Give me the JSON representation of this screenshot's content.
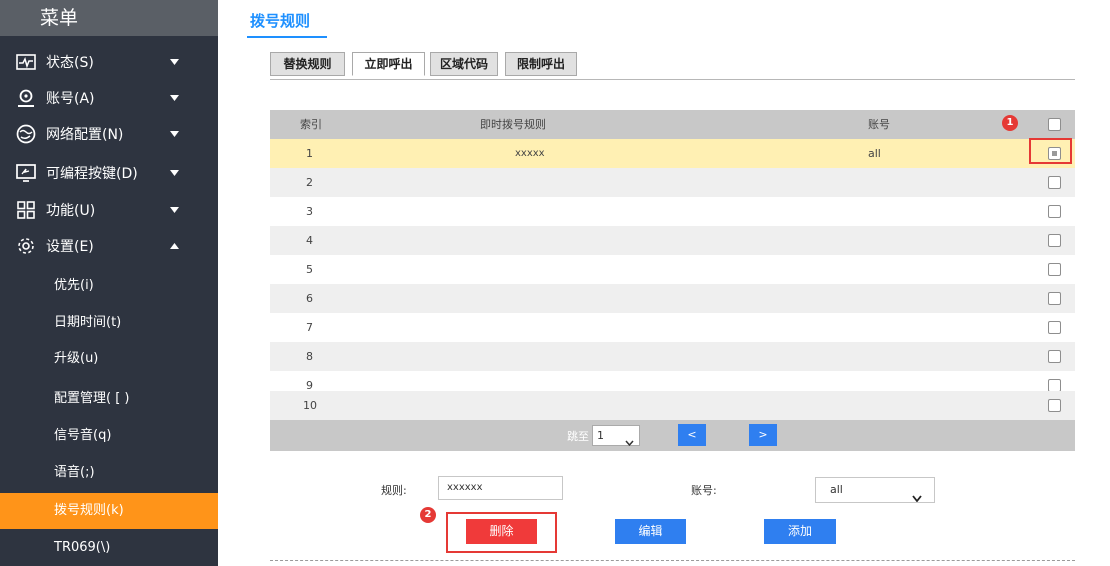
{
  "sidebar": {
    "title": "菜单",
    "items": [
      {
        "label": "状态(S)",
        "icon": "status-icon",
        "expanded": false
      },
      {
        "label": "账号(A)",
        "icon": "account-icon",
        "expanded": false
      },
      {
        "label": "网络配置(N)",
        "icon": "network-icon",
        "expanded": false
      },
      {
        "label": "可编程按键(D)",
        "icon": "programmable-key-icon",
        "expanded": false
      },
      {
        "label": "功能(U)",
        "icon": "features-icon",
        "expanded": false
      },
      {
        "label": "设置(E)",
        "icon": "settings-icon",
        "expanded": true
      }
    ],
    "sub_items": [
      {
        "label": "优先(i)"
      },
      {
        "label": "日期时间(t)"
      },
      {
        "label": "升级(u)"
      },
      {
        "label": "配置管理( [ )"
      },
      {
        "label": "信号音(q)"
      },
      {
        "label": "语音(;)"
      },
      {
        "label": "拨号规则(k)",
        "active": true
      },
      {
        "label": "TR069(\\)"
      }
    ]
  },
  "main": {
    "title": "拨号规则",
    "tabs": [
      {
        "label": "替换规则",
        "active": false
      },
      {
        "label": "立即呼出",
        "active": true
      },
      {
        "label": "区域代码",
        "active": false
      },
      {
        "label": "限制呼出",
        "active": false
      }
    ],
    "table": {
      "headers": {
        "index": "索引",
        "rule": "即时拨号规则",
        "account": "账号"
      },
      "rows": [
        {
          "index": "1",
          "rule": "xxxxx",
          "account": "all",
          "selected": true
        },
        {
          "index": "2",
          "rule": "",
          "account": ""
        },
        {
          "index": "3",
          "rule": "",
          "account": ""
        },
        {
          "index": "4",
          "rule": "",
          "account": ""
        },
        {
          "index": "5",
          "rule": "",
          "account": ""
        },
        {
          "index": "6",
          "rule": "",
          "account": ""
        },
        {
          "index": "7",
          "rule": "",
          "account": ""
        },
        {
          "index": "8",
          "rule": "",
          "account": ""
        },
        {
          "index": "9",
          "rule": "",
          "account": ""
        },
        {
          "index": "10",
          "rule": "",
          "account": ""
        }
      ]
    },
    "pager": {
      "jump_label": "跳至",
      "page_value": "1",
      "prev_label": "<",
      "next_label": ">"
    },
    "form": {
      "rule_label": "规则:",
      "rule_value": "xxxxxx",
      "account_label": "账号:",
      "account_value": "all"
    },
    "buttons": {
      "delete": "删除",
      "edit": "编辑",
      "add": "添加"
    },
    "annotations": {
      "marker_1": "1",
      "marker_2": "2",
      "color": "#e53935"
    }
  },
  "colors": {
    "sidebar_bg": "#2e3440",
    "sidebar_header_bg": "#5a5f66",
    "active_item": "#ff9419",
    "accent_blue": "#1e90ff",
    "button_blue": "#2f7ff0",
    "button_red": "#f03a3a",
    "selected_row": "#fff0b3"
  }
}
